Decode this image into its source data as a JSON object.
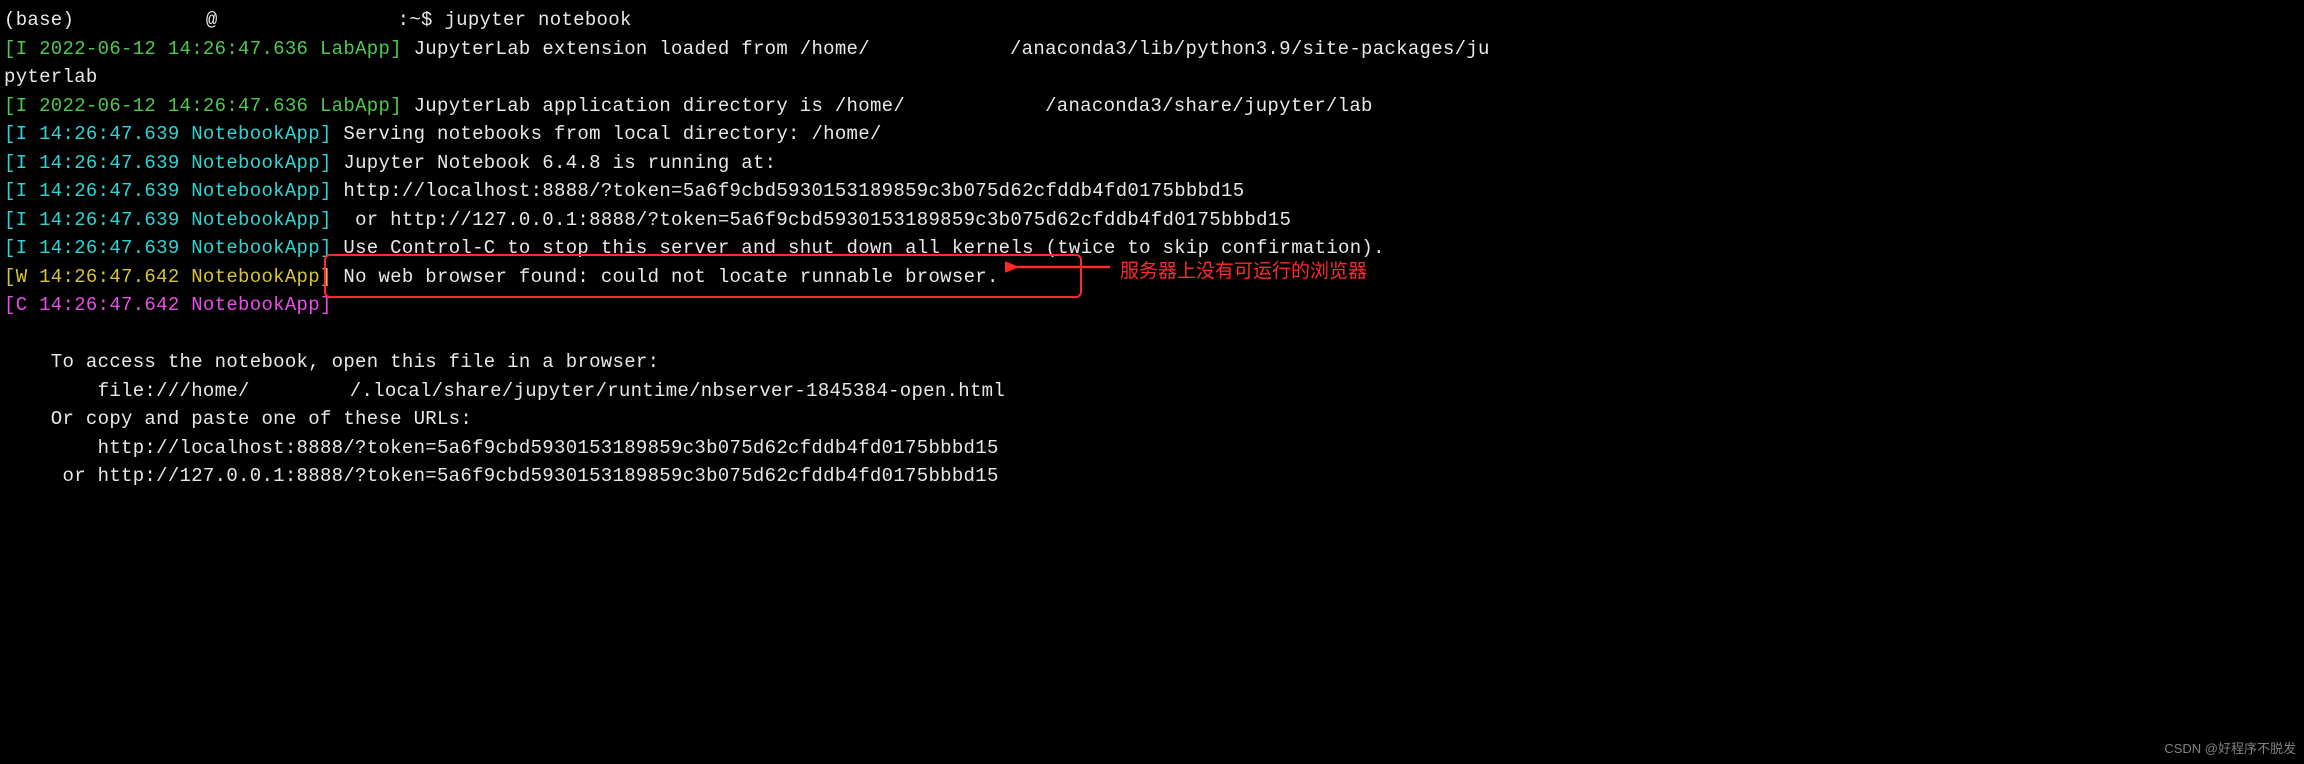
{
  "prompt": {
    "prefix": "(base) ",
    "host_suffix": ":~$ ",
    "command": "jupyter notebook"
  },
  "log": {
    "l1": {
      "tag_open": "[",
      "level": "I ",
      "ts": "2022-06-12 14:26:47.636 ",
      "app": "LabApp",
      "tag_close": "] ",
      "msg_a": "JupyterLab extension loaded from /home/",
      "msg_b": "/anaconda3/lib/python3.9/site-packages/ju"
    },
    "l1b": "pyterlab",
    "l2": {
      "tag_open": "[",
      "level": "I ",
      "ts": "2022-06-12 14:26:47.636 ",
      "app": "LabApp",
      "tag_close": "] ",
      "msg_a": "JupyterLab application directory is /home/",
      "msg_b": "/anaconda3/share/jupyter/lab"
    },
    "l3": {
      "tag_open": "[",
      "level": "I ",
      "ts": "14:26:47.639 ",
      "app": "NotebookApp",
      "tag_close": "] ",
      "msg_a": "Serving notebooks from local directory: /home/"
    },
    "l4": {
      "tag_open": "[",
      "level": "I ",
      "ts": "14:26:47.639 ",
      "app": "NotebookApp",
      "tag_close": "] ",
      "msg": "Jupyter Notebook 6.4.8 is running at:"
    },
    "l5": {
      "tag_open": "[",
      "level": "I ",
      "ts": "14:26:47.639 ",
      "app": "NotebookApp",
      "tag_close": "] ",
      "msg": "http://localhost:8888/?token=5a6f9cbd5930153189859c3b075d62cfddb4fd0175bbbd15"
    },
    "l6": {
      "tag_open": "[",
      "level": "I ",
      "ts": "14:26:47.639 ",
      "app": "NotebookApp",
      "tag_close": "] ",
      "msg": " or http://127.0.0.1:8888/?token=5a6f9cbd5930153189859c3b075d62cfddb4fd0175bbbd15"
    },
    "l7": {
      "tag_open": "[",
      "level": "I ",
      "ts": "14:26:47.639 ",
      "app": "NotebookApp",
      "tag_close": "] ",
      "msg": "Use Control-C to stop this server and shut down all kernels (twice to skip confirmation)."
    },
    "l8": {
      "tag_open": "[",
      "level": "W ",
      "ts": "14:26:47.642 ",
      "app": "NotebookApp",
      "tag_close": "] ",
      "msg": "No web browser found: could not locate runnable browser."
    },
    "l9": {
      "tag_open": "[",
      "level": "C ",
      "ts": "14:26:47.642 ",
      "app": "NotebookApp",
      "tag_close": "]"
    }
  },
  "access": {
    "l1": "    To access the notebook, open this file in a browser:",
    "l2a": "        file:///home/",
    "l2b": "/.local/share/jupyter/runtime/nbserver-1845384-open.html",
    "l3": "    Or copy and paste one of these URLs:",
    "l4": "        http://localhost:8888/?token=5a6f9cbd5930153189859c3b075d62cfddb4fd0175bbbd15",
    "l5": "     or http://127.0.0.1:8888/?token=5a6f9cbd5930153189859c3b075d62cfddb4fd0175bbbd15"
  },
  "annotation": "服务器上没有可运行的浏览器",
  "watermark": "CSDN @好程序不脱发"
}
